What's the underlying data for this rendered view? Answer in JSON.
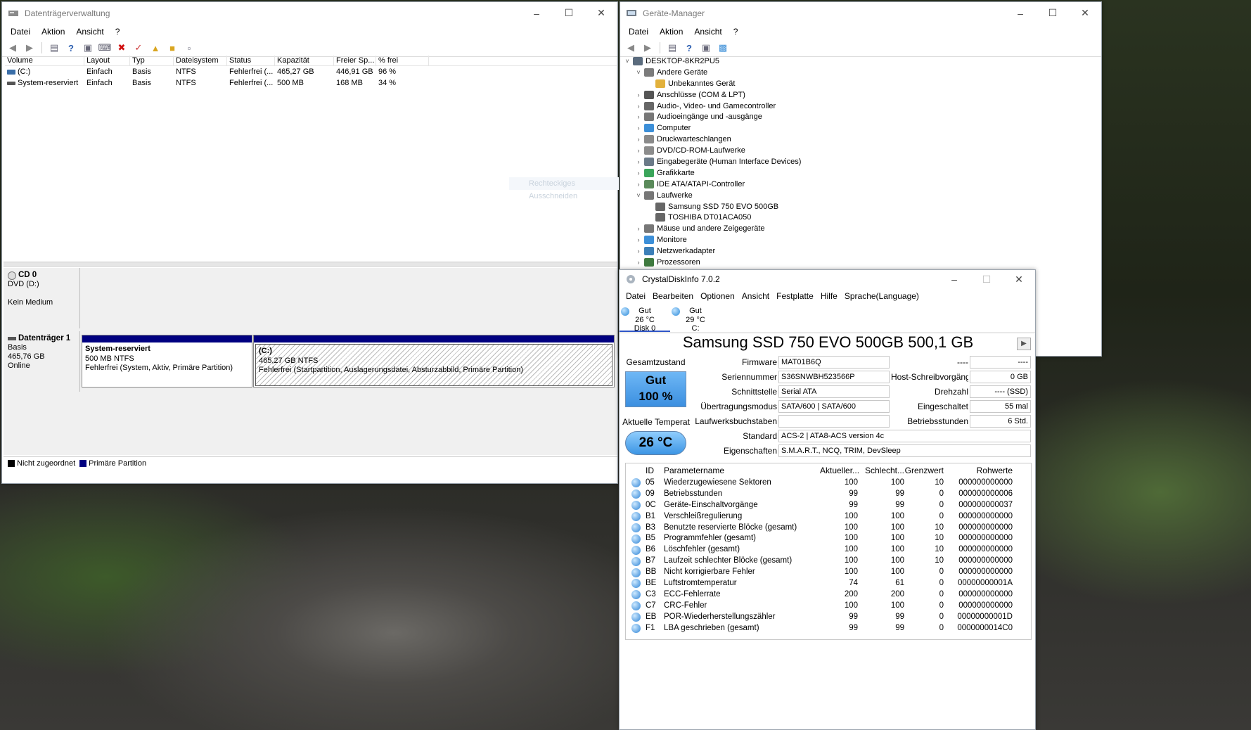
{
  "dm": {
    "title": "Datenträgerverwaltung",
    "menu": [
      "Datei",
      "Aktion",
      "Ansicht",
      "?"
    ],
    "columns": [
      "Volume",
      "Layout",
      "Typ",
      "Dateisystem",
      "Status",
      "Kapazität",
      "Freier Sp...",
      "% frei"
    ],
    "volumes": [
      {
        "volume": "(C:)",
        "layout": "Einfach",
        "typ": "Basis",
        "fs": "NTFS",
        "status": "Fehlerfrei (...",
        "capacity": "465,27 GB",
        "free": "446,91 GB",
        "pct": "96 %"
      },
      {
        "volume": "System-reserviert",
        "layout": "Einfach",
        "typ": "Basis",
        "fs": "NTFS",
        "status": "Fehlerfrei (...",
        "capacity": "500 MB",
        "free": "168 MB",
        "pct": "34 %"
      }
    ],
    "cd": {
      "name": "CD 0",
      "line1": "DVD (D:)",
      "line2": "Kein Medium"
    },
    "disk1": {
      "name": "Datenträger 1",
      "type": "Basis",
      "size": "465,76 GB",
      "state": "Online"
    },
    "part_sys": {
      "title": "System-reserviert",
      "size": "500 MB NTFS",
      "status": "Fehlerfrei (System, Aktiv, Primäre Partition)"
    },
    "part_c": {
      "title": "(C:)",
      "size": "465,27 GB NTFS",
      "status": "Fehlerfrei (Startpartition, Auslagerungsdatei, Absturzabbild, Primäre Partition)"
    },
    "legend": [
      "Nicht zugeordnet",
      "Primäre Partition"
    ],
    "colors": {
      "unallocated": "#000000",
      "primary": "#000080"
    }
  },
  "gm": {
    "title": "Geräte-Manager",
    "menu": [
      "Datei",
      "Aktion",
      "Ansicht",
      "?"
    ],
    "ghost": "Rechteckiges Ausschneiden",
    "tree": [
      {
        "label": "DESKTOP-8KR2PU5",
        "level": 0,
        "exp": "v",
        "color": "#5a6b7d"
      },
      {
        "label": "Andere Geräte",
        "level": 1,
        "exp": "v",
        "color": "#7b7b7b"
      },
      {
        "label": "Unbekanntes Gerät",
        "level": 2,
        "exp": "",
        "color": "#e2b13c"
      },
      {
        "label": "Anschlüsse (COM & LPT)",
        "level": 1,
        "exp": ">",
        "color": "#555"
      },
      {
        "label": "Audio-, Video- und Gamecontroller",
        "level": 1,
        "exp": ">",
        "color": "#666"
      },
      {
        "label": "Audioeingänge und -ausgänge",
        "level": 1,
        "exp": ">",
        "color": "#777"
      },
      {
        "label": "Computer",
        "level": 1,
        "exp": ">",
        "color": "#3c8fd8"
      },
      {
        "label": "Druckwarteschlangen",
        "level": 1,
        "exp": ">",
        "color": "#8a8a8a"
      },
      {
        "label": "DVD/CD-ROM-Laufwerke",
        "level": 1,
        "exp": ">",
        "color": "#8c8c8c"
      },
      {
        "label": "Eingabegeräte (Human Interface Devices)",
        "level": 1,
        "exp": ">",
        "color": "#6b7a88"
      },
      {
        "label": "Grafikkarte",
        "level": 1,
        "exp": ">",
        "color": "#3aa55a"
      },
      {
        "label": "IDE ATA/ATAPI-Controller",
        "level": 1,
        "exp": ">",
        "color": "#5a8a5a"
      },
      {
        "label": "Laufwerke",
        "level": 1,
        "exp": "v",
        "color": "#777"
      },
      {
        "label": "Samsung SSD 750 EVO 500GB",
        "level": 2,
        "exp": "",
        "color": "#666"
      },
      {
        "label": "TOSHIBA DT01ACA050",
        "level": 2,
        "exp": "",
        "color": "#666"
      },
      {
        "label": "Mäuse und andere Zeigegeräte",
        "level": 1,
        "exp": ">",
        "color": "#777"
      },
      {
        "label": "Monitore",
        "level": 1,
        "exp": ">",
        "color": "#3c8fd8"
      },
      {
        "label": "Netzwerkadapter",
        "level": 1,
        "exp": ">",
        "color": "#3c7fb8"
      },
      {
        "label": "Prozessoren",
        "level": 1,
        "exp": ">",
        "color": "#3f7a3f"
      }
    ]
  },
  "cdi": {
    "title": "CrystalDiskInfo 7.0.2",
    "menu": [
      "Datei",
      "Bearbeiten",
      "Optionen",
      "Ansicht",
      "Festplatte",
      "Hilfe",
      "Sprache(Language)"
    ],
    "tabs": [
      {
        "status": "Gut",
        "temp": "26 °C",
        "name": "Disk 0"
      },
      {
        "status": "Gut",
        "temp": "29 °C",
        "name": "C:"
      }
    ],
    "model": "Samsung SSD 750 EVO 500GB 500,1 GB",
    "labels": {
      "health": "Gesamtzustand",
      "temp": "Aktuelle Temperat",
      "firmware": "Firmware",
      "serial": "Seriennummer",
      "interface": "Schnittstelle",
      "transfer": "Übertragungsmodus",
      "letters": "Laufwerksbuchstaben",
      "standard": "Standard",
      "features": "Eigenschaften",
      "host_writes": "Host-Schreibvorgänge",
      "rotation": "Drehzahl",
      "power_count": "Eingeschaltet",
      "power_hours": "Betriebsstunden",
      "blank_label": "----"
    },
    "values": {
      "health_status": "Gut",
      "health_pct": "100 %",
      "temp": "26 °C",
      "firmware": "MAT01B6Q",
      "serial": "S36SNWBH523566P",
      "interface": "Serial ATA",
      "transfer": "SATA/600 | SATA/600",
      "letters": "",
      "standard": "ACS-2 | ATA8-ACS version 4c",
      "features": "S.M.A.R.T., NCQ, TRIM, DevSleep",
      "blank_value": "----",
      "host_writes": "0 GB",
      "rotation": "---- (SSD)",
      "power_count": "55 mal",
      "power_hours": "6 Std."
    },
    "smart_columns": [
      "ID",
      "Parametername",
      "Aktueller...",
      "Schlecht...",
      "Grenzwert",
      "Rohwerte"
    ],
    "smart": [
      {
        "id": "05",
        "name": "Wiederzugewiesene Sektoren",
        "cur": "100",
        "worst": "100",
        "thr": "10",
        "raw": "000000000000"
      },
      {
        "id": "09",
        "name": "Betriebsstunden",
        "cur": "99",
        "worst": "99",
        "thr": "0",
        "raw": "000000000006"
      },
      {
        "id": "0C",
        "name": "Geräte-Einschaltvorgänge",
        "cur": "99",
        "worst": "99",
        "thr": "0",
        "raw": "000000000037"
      },
      {
        "id": "B1",
        "name": "Verschleißregulierung",
        "cur": "100",
        "worst": "100",
        "thr": "0",
        "raw": "000000000000"
      },
      {
        "id": "B3",
        "name": "Benutzte reservierte Blöcke (gesamt)",
        "cur": "100",
        "worst": "100",
        "thr": "10",
        "raw": "000000000000"
      },
      {
        "id": "B5",
        "name": "Programmfehler (gesamt)",
        "cur": "100",
        "worst": "100",
        "thr": "10",
        "raw": "000000000000"
      },
      {
        "id": "B6",
        "name": "Löschfehler (gesamt)",
        "cur": "100",
        "worst": "100",
        "thr": "10",
        "raw": "000000000000"
      },
      {
        "id": "B7",
        "name": "Laufzeit schlechter Blöcke (gesamt)",
        "cur": "100",
        "worst": "100",
        "thr": "10",
        "raw": "000000000000"
      },
      {
        "id": "BB",
        "name": "Nicht korrigierbare Fehler",
        "cur": "100",
        "worst": "100",
        "thr": "0",
        "raw": "000000000000"
      },
      {
        "id": "BE",
        "name": "Luftstromtemperatur",
        "cur": "74",
        "worst": "61",
        "thr": "0",
        "raw": "00000000001A"
      },
      {
        "id": "C3",
        "name": "ECC-Fehlerrate",
        "cur": "200",
        "worst": "200",
        "thr": "0",
        "raw": "000000000000"
      },
      {
        "id": "C7",
        "name": "CRC-Fehler",
        "cur": "100",
        "worst": "100",
        "thr": "0",
        "raw": "000000000000"
      },
      {
        "id": "EB",
        "name": "POR-Wiederherstellungszähler",
        "cur": "99",
        "worst": "99",
        "thr": "0",
        "raw": "00000000001D"
      },
      {
        "id": "F1",
        "name": "LBA geschrieben (gesamt)",
        "cur": "99",
        "worst": "99",
        "thr": "0",
        "raw": "0000000014C0"
      }
    ]
  }
}
